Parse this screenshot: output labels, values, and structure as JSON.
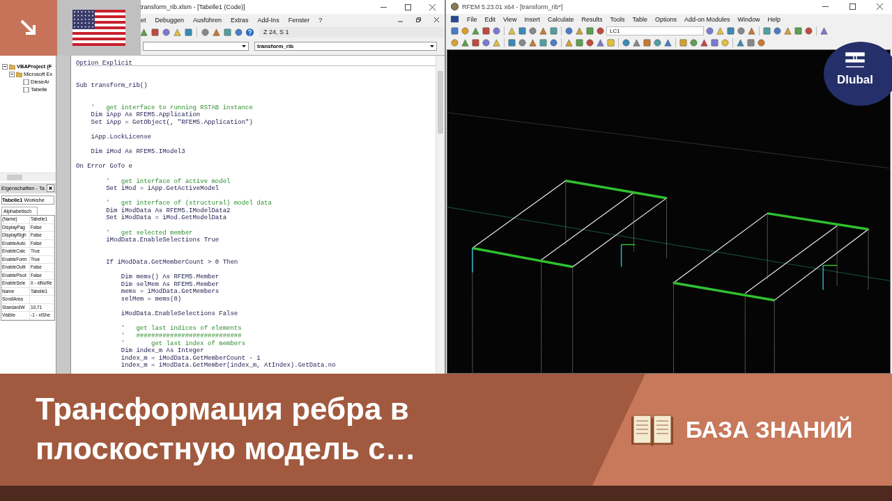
{
  "vba_editor": {
    "title": "transform_rib.xlsm - [Tabelle1 (Code)]",
    "menu": [
      "et",
      "Debuggen",
      "Ausführen",
      "Extras",
      "Add-Ins",
      "Fenster",
      "?"
    ],
    "cursor_position": "Z 24, S 1",
    "procedure_dropdown": "transform_rib",
    "project_tree": [
      {
        "label": "VBAProject (F",
        "expanded": true,
        "children": [
          {
            "label": "Microsoft Ex",
            "expanded": true,
            "children": [
              {
                "label": "DieseAr"
              },
              {
                "label": "Tabelle"
              }
            ]
          }
        ]
      }
    ],
    "properties": {
      "title": "Eigenschaften - Ta",
      "object": "Tabelle1",
      "object_type": "Workshe",
      "tab": "Alphabetisch",
      "rows": [
        {
          "name": "(Name)",
          "value": "Tabelle1"
        },
        {
          "name": "DisplayPag",
          "value": "False"
        },
        {
          "name": "DisplayRigh",
          "value": "False"
        },
        {
          "name": "EnableAuto",
          "value": "False"
        },
        {
          "name": "EnableCalc",
          "value": "True"
        },
        {
          "name": "EnableForm",
          "value": "True"
        },
        {
          "name": "EnableOutli",
          "value": "False"
        },
        {
          "name": "EnablePivot",
          "value": "False"
        },
        {
          "name": "EnableSele",
          "value": "0 - xlNoRe"
        },
        {
          "name": "Name",
          "value": "Tabelle1"
        },
        {
          "name": "ScrollArea"
        },
        {
          "name": "StandardW",
          "value": "10,71"
        },
        {
          "name": "Visible",
          "value": "-1 - xlShe"
        }
      ]
    },
    "code_lines": [
      {
        "kind": "code",
        "text": "Option Explicit"
      },
      {
        "kind": "separator"
      },
      {
        "kind": "blank"
      },
      {
        "kind": "code",
        "text": "Sub transform_rib()"
      },
      {
        "kind": "blank"
      },
      {
        "kind": "blank"
      },
      {
        "kind": "comment",
        "text": "    '   get interface to running RSTAB instance"
      },
      {
        "kind": "code",
        "text": "    Dim iApp As RFEM5.Application"
      },
      {
        "kind": "code",
        "text": "    Set iApp = GetObject(, \"RFEM5.Application\")"
      },
      {
        "kind": "blank"
      },
      {
        "kind": "code",
        "text": "    iApp.LockLicense"
      },
      {
        "kind": "blank"
      },
      {
        "kind": "code",
        "text": "    Dim iMod As RFEM5.IModel3"
      },
      {
        "kind": "blank"
      },
      {
        "kind": "code",
        "text": "On Error GoTo e"
      },
      {
        "kind": "blank"
      },
      {
        "kind": "comment",
        "text": "        '   get interface of active model"
      },
      {
        "kind": "code",
        "text": "        Set iMod = iApp.GetActiveModel"
      },
      {
        "kind": "blank"
      },
      {
        "kind": "comment",
        "text": "        '   get interface of (structural) model data"
      },
      {
        "kind": "code",
        "text": "        Dim iModData As RFEM5.IModelData2"
      },
      {
        "kind": "code",
        "text": "        Set iModData = iMod.GetModelData"
      },
      {
        "kind": "blank"
      },
      {
        "kind": "comment",
        "text": "        '   get selected member"
      },
      {
        "kind": "code",
        "text": "        iModData.EnableSelections True"
      },
      {
        "kind": "blank"
      },
      {
        "kind": "blank"
      },
      {
        "kind": "code",
        "text": "        If iModData.GetMemberCount > 0 Then"
      },
      {
        "kind": "blank"
      },
      {
        "kind": "code",
        "text": "            Dim mems() As RFEM5.Member"
      },
      {
        "kind": "code",
        "text": "            Dim selMem As RFEM5.Member"
      },
      {
        "kind": "code",
        "text": "            mems = iModData.GetMembers"
      },
      {
        "kind": "code",
        "text": "            selMem = mems(0)"
      },
      {
        "kind": "blank"
      },
      {
        "kind": "code",
        "text": "            iModData.EnableSelections False"
      },
      {
        "kind": "blank"
      },
      {
        "kind": "comment",
        "text": "            '   get last indices of elements"
      },
      {
        "kind": "comment",
        "text": "            '   ############################"
      },
      {
        "kind": "comment",
        "text": "            '       get last index of members"
      },
      {
        "kind": "code",
        "text": "            Dim index_m As Integer"
      },
      {
        "kind": "code",
        "text": "            index_m = iModData.GetMemberCount - 1"
      },
      {
        "kind": "code",
        "text": "            index_m = iModData.GetMember(index_m, AtIndex).GetData.no"
      }
    ]
  },
  "rfem": {
    "title": "RFEM 5.23.01 x64 - [transform_rib*]",
    "menu": [
      "File",
      "Edit",
      "View",
      "Insert",
      "Calculate",
      "Results",
      "Tools",
      "Table",
      "Options",
      "Add-on Modules",
      "Window",
      "Help"
    ],
    "load_case": "LC1"
  },
  "logo": {
    "text": "Dlubal"
  },
  "banner": {
    "title": "Трансформация ребра в плоскостную модель с…",
    "category": "БАЗА ЗНАНИЙ"
  }
}
